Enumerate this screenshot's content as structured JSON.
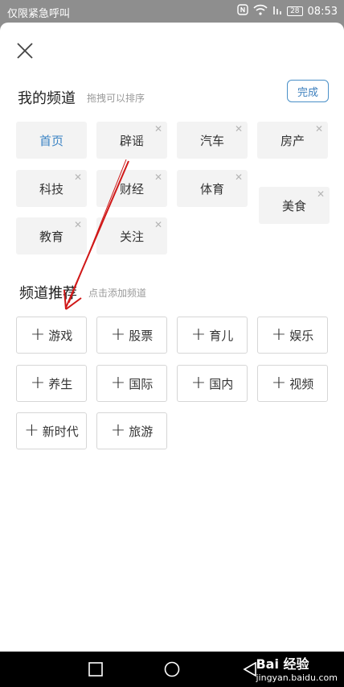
{
  "status_bar": {
    "carrier": "仅限紧急呼叫",
    "battery": "28",
    "time": "08:53"
  },
  "my_channels": {
    "title": "我的频道",
    "hint": "拖拽可以排序",
    "done_label": "完成",
    "items": [
      {
        "label": "首页",
        "active": true
      },
      {
        "label": "辟谣"
      },
      {
        "label": "汽车"
      },
      {
        "label": "房产"
      },
      {
        "label": "科技"
      },
      {
        "label": "财经"
      },
      {
        "label": "体育"
      },
      {
        "label": "美食"
      },
      {
        "label": "教育"
      },
      {
        "label": "关注"
      }
    ]
  },
  "recommended": {
    "title": "频道推荐",
    "hint": "点击添加频道",
    "items": [
      {
        "label": "游戏"
      },
      {
        "label": "股票"
      },
      {
        "label": "育儿"
      },
      {
        "label": "娱乐"
      },
      {
        "label": "养生"
      },
      {
        "label": "国际"
      },
      {
        "label": "国内"
      },
      {
        "label": "视频"
      },
      {
        "label": "新时代"
      },
      {
        "label": "旅游"
      }
    ]
  },
  "watermark": {
    "brand": "Bai 经验",
    "url": "jingyan.baidu.com"
  },
  "colors": {
    "accent": "#3c84c4",
    "arrow": "#d01818"
  }
}
